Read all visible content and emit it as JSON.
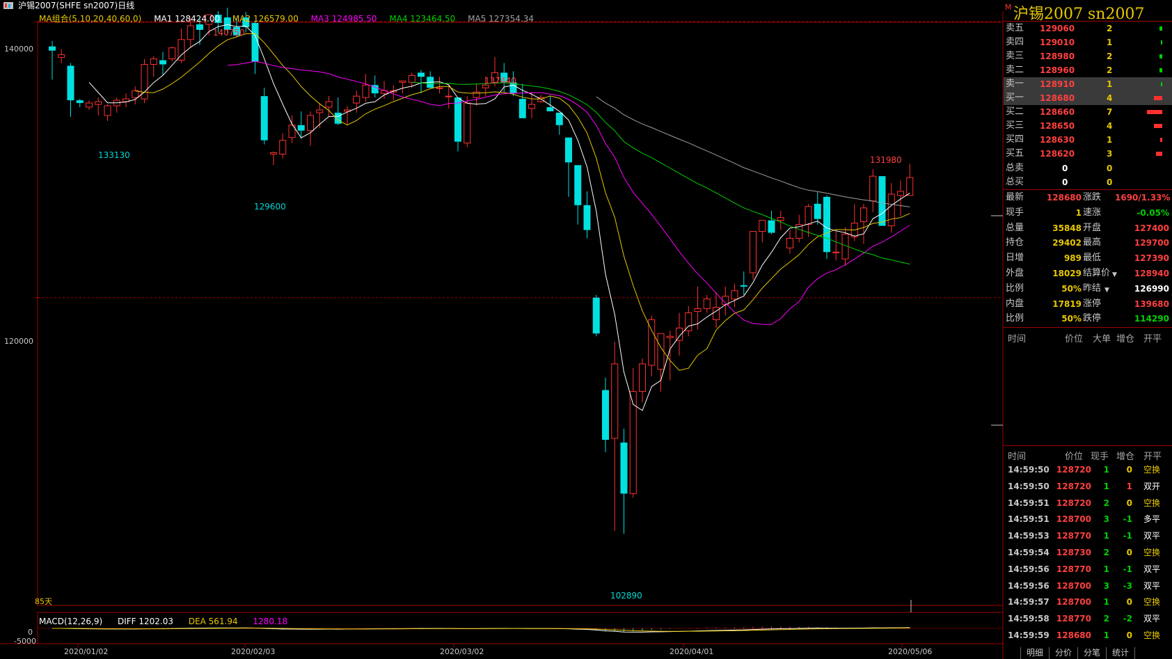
{
  "title": "沪锡2007(SHFE sn2007)日线",
  "ma": {
    "combo": "MA组合(5,10,20,40,60,0)",
    "items": [
      {
        "label": "MA1 128424.00",
        "color": "#ffffff"
      },
      {
        "label": "MA2 126579.00",
        "color": "#e8c800"
      },
      {
        "label": "MA3 124985.50",
        "color": "#ff00ff"
      },
      {
        "label": "MA4 123464.50",
        "color": "#00d000"
      },
      {
        "label": "MA5 127354.34",
        "color": "#a0a0a0"
      }
    ]
  },
  "annotations": {
    "high1": "140750",
    "low1": "133130",
    "low2": "129600",
    "high2": "137440",
    "low3": "102890",
    "high3": "131980"
  },
  "yaxis": {
    "t140k": "140000",
    "t120k": "120000",
    "m0": "0",
    "mneg": "-5000"
  },
  "xaxis": [
    "2020/01/02",
    "2020/02/03",
    "2020/03/02",
    "2020/04/01",
    "2020/05/06"
  ],
  "days_label": "85天",
  "macd": {
    "name": "MACD(12,26,9)",
    "diff": "DIFF 1202.03",
    "dea": "DEA 561.94",
    "macd": "1280.18"
  },
  "chart_data": {
    "type": "candlestick",
    "ylim": [
      101000,
      142500
    ],
    "candles": [
      [
        138200,
        138600,
        135800,
        137900
      ],
      [
        137400,
        138000,
        137000,
        137600
      ],
      [
        136800,
        137000,
        133100,
        134300
      ],
      [
        134300,
        134400,
        133800,
        134100
      ],
      [
        133800,
        134300,
        133600,
        134100
      ],
      [
        134000,
        134500,
        133200,
        134200
      ],
      [
        133200,
        134000,
        132800,
        133900
      ],
      [
        133900,
        134500,
        133400,
        134300
      ],
      [
        134200,
        134800,
        133800,
        134400
      ],
      [
        134500,
        135300,
        134000,
        135000
      ],
      [
        134400,
        137300,
        134100,
        136900
      ],
      [
        136900,
        137500,
        136000,
        137300
      ],
      [
        137200,
        137800,
        136100,
        136900
      ],
      [
        137300,
        138200,
        137100,
        138100
      ],
      [
        137200,
        139500,
        137000,
        138700
      ],
      [
        138700,
        140300,
        138100,
        139700
      ],
      [
        139800,
        140200,
        138300,
        139400
      ],
      [
        139800,
        140100,
        139000,
        140500
      ],
      [
        140500,
        140750,
        139200,
        139900
      ],
      [
        140300,
        141000,
        139200,
        139400
      ],
      [
        139600,
        140300,
        138900,
        139000
      ],
      [
        140300,
        140700,
        139200,
        139600
      ],
      [
        139900,
        140000,
        136200,
        137100
      ],
      [
        134600,
        135200,
        131100,
        131400
      ],
      [
        130400,
        130600,
        129600,
        130500
      ],
      [
        130400,
        131900,
        130100,
        131400
      ],
      [
        131600,
        133200,
        131200,
        132500
      ],
      [
        132500,
        133500,
        131500,
        132100
      ],
      [
        132100,
        133500,
        131000,
        133200
      ],
      [
        133400,
        134100,
        132300,
        133600
      ],
      [
        133800,
        134600,
        133100,
        134200
      ],
      [
        133400,
        134500,
        132500,
        132600
      ],
      [
        133500,
        133900,
        132500,
        133600
      ],
      [
        134100,
        135000,
        133400,
        134600
      ],
      [
        134500,
        136200,
        134200,
        135400
      ],
      [
        135400,
        136100,
        134500,
        134800
      ],
      [
        134800,
        135700,
        134400,
        135000
      ],
      [
        134900,
        135400,
        134300,
        135000
      ],
      [
        135600,
        135700,
        134800,
        135700
      ],
      [
        135600,
        136300,
        135200,
        136100
      ],
      [
        136300,
        136500,
        134800,
        136000
      ],
      [
        136000,
        136400,
        135300,
        135200
      ],
      [
        135200,
        136000,
        134800,
        135200
      ],
      [
        134600,
        135400,
        133700,
        134600
      ],
      [
        134500,
        134500,
        130600,
        131300
      ],
      [
        131200,
        134600,
        130900,
        134100
      ],
      [
        134500,
        135500,
        133900,
        134900
      ],
      [
        135200,
        136000,
        134600,
        135400
      ],
      [
        135600,
        137440,
        135300,
        136300
      ],
      [
        136300,
        137000,
        134900,
        135600
      ],
      [
        135600,
        136400,
        134600,
        134800
      ],
      [
        134400,
        135500,
        133400,
        133000
      ],
      [
        133700,
        134900,
        133000,
        134000
      ],
      [
        134200,
        134700,
        134100,
        134500
      ],
      [
        133800,
        134600,
        133700,
        133500
      ],
      [
        133400,
        133400,
        131800,
        132500
      ],
      [
        131600,
        131600,
        127300,
        129800
      ],
      [
        129600,
        129600,
        125300,
        126700
      ],
      [
        126700,
        127700,
        124300,
        124900
      ],
      [
        120000,
        120200,
        117200,
        117400
      ],
      [
        113300,
        114200,
        108800,
        109700
      ],
      [
        109800,
        116800,
        103100,
        115200
      ],
      [
        109500,
        110500,
        102890,
        105800
      ],
      [
        105800,
        114900,
        105500,
        113200
      ],
      [
        113200,
        115600,
        112400,
        115200
      ],
      [
        115100,
        118700,
        114300,
        118400
      ],
      [
        114800,
        117300,
        113200,
        117400
      ],
      [
        117100,
        117600,
        114000,
        117200
      ],
      [
        116900,
        118900,
        115800,
        117800
      ],
      [
        117600,
        119400,
        117200,
        118900
      ],
      [
        119000,
        120800,
        117700,
        119200
      ],
      [
        119200,
        120200,
        118900,
        119900
      ],
      [
        118400,
        120400,
        117800,
        119300
      ],
      [
        119500,
        120800,
        118700,
        120100
      ],
      [
        119900,
        121000,
        119300,
        120500
      ],
      [
        120900,
        121900,
        120200,
        120800
      ],
      [
        121800,
        124000,
        121300,
        124800
      ],
      [
        124800,
        125500,
        124000,
        125600
      ],
      [
        125600,
        126300,
        124600,
        124700
      ],
      [
        125600,
        126300,
        124900,
        125800
      ],
      [
        123600,
        124900,
        123200,
        124300
      ],
      [
        124300,
        126000,
        124000,
        125300
      ],
      [
        125300,
        126800,
        124400,
        126600
      ],
      [
        126800,
        127700,
        125300,
        125700
      ],
      [
        127300,
        127400,
        122800,
        123300
      ],
      [
        123300,
        124900,
        122700,
        123300
      ],
      [
        122800,
        125100,
        122300,
        124600
      ],
      [
        124400,
        126800,
        124100,
        125400
      ],
      [
        125500,
        126800,
        123900,
        126500
      ],
      [
        127000,
        129300,
        126200,
        128800
      ],
      [
        128800,
        128800,
        126300,
        125200
      ],
      [
        125200,
        128300,
        124700,
        127500
      ],
      [
        127400,
        128500,
        125900,
        127700
      ],
      [
        127400,
        129700,
        127400,
        128700
      ]
    ]
  },
  "right": {
    "title": "沪锡2007  sn2007",
    "mark": "M",
    "orderbook": [
      {
        "name": "卖五",
        "price": "129060",
        "vol": "2",
        "bar": 4,
        "barColor": "#00d000"
      },
      {
        "name": "卖四",
        "price": "129010",
        "vol": "1",
        "bar": 2,
        "barColor": "#00d000"
      },
      {
        "name": "卖三",
        "price": "128980",
        "vol": "2",
        "bar": 4,
        "barColor": "#00d000"
      },
      {
        "name": "卖二",
        "price": "128960",
        "vol": "2",
        "bar": 4,
        "barColor": "#00d000"
      },
      {
        "name": "卖一",
        "price": "128910",
        "vol": "1",
        "bar": 2,
        "barColor": "#00d000",
        "sel": true
      },
      {
        "name": "买一",
        "price": "128680",
        "vol": "4",
        "bar": 12,
        "barColor": "#ff3030",
        "sel": true
      },
      {
        "name": "买二",
        "price": "128660",
        "vol": "7",
        "bar": 22,
        "barColor": "#ff3030"
      },
      {
        "name": "买三",
        "price": "128650",
        "vol": "4",
        "bar": 12,
        "barColor": "#ff3030"
      },
      {
        "name": "买四",
        "price": "128630",
        "vol": "1",
        "bar": 3,
        "barColor": "#ff3030"
      },
      {
        "name": "买五",
        "price": "128620",
        "vol": "3",
        "bar": 9,
        "barColor": "#ff3030"
      }
    ],
    "totals": [
      {
        "name": "总卖",
        "v1": "0",
        "v2": "0"
      },
      {
        "name": "总买",
        "v1": "0",
        "v2": "0"
      }
    ],
    "quote": [
      {
        "k1": "最新",
        "v1": "128680",
        "c1": "#ff4040",
        "k2": "涨跌",
        "v2": "1690/1.33%",
        "c2": "#ff4040"
      },
      {
        "k1": "现手",
        "v1": "1",
        "c1": "#e8c800",
        "k2": "速涨",
        "v2": "-0.05%",
        "c2": "#00d000"
      },
      {
        "k1": "总量",
        "v1": "35848",
        "c1": "#e8c800",
        "k2": "开盘",
        "v2": "127400",
        "c2": "#ff4040"
      },
      {
        "k1": "持仓",
        "v1": "29402",
        "c1": "#e8c800",
        "k2": "最高",
        "v2": "129700",
        "c2": "#ff4040"
      },
      {
        "k1": "日增",
        "v1": "989",
        "c1": "#e8c800",
        "k2": "最低",
        "v2": "127390",
        "c2": "#ff4040"
      },
      {
        "k1": "外盘",
        "v1": "18029",
        "c1": "#e8c800",
        "k2": "结算价",
        "v2": "128940",
        "c2": "#ff4040"
      },
      {
        "k1": "比例",
        "v1": "50%",
        "c1": "#e8c800",
        "k2": "昨结",
        "v2": "126990",
        "c2": "#ffffff"
      },
      {
        "k1": "内盘",
        "v1": "17819",
        "c1": "#e8c800",
        "k2": "涨停",
        "v2": "139680",
        "c2": "#ff4040"
      },
      {
        "k1": "比例",
        "v1": "50%",
        "c1": "#e8c800",
        "k2": "跌停",
        "v2": "114290",
        "c2": "#00d000"
      }
    ],
    "bigorder_header": {
      "time": "时间",
      "price": "价位",
      "big": "大单",
      "inc": "增仓",
      "oc": "开平"
    },
    "tick_header": {
      "time": "时间",
      "price": "价位",
      "now": "现手",
      "inc": "增仓",
      "oc": "开平"
    },
    "ticks": [
      {
        "time": "14:59:50",
        "price": "128720",
        "now": "1",
        "inc": "0",
        "oc": "空换"
      },
      {
        "time": "14:59:50",
        "price": "128720",
        "now": "1",
        "inc": "1",
        "oc": "双开"
      },
      {
        "time": "14:59:51",
        "price": "128720",
        "now": "2",
        "inc": "0",
        "oc": "空换"
      },
      {
        "time": "14:59:51",
        "price": "128700",
        "now": "3",
        "inc": "-1",
        "oc": "多平"
      },
      {
        "time": "14:59:53",
        "price": "128770",
        "now": "1",
        "inc": "-1",
        "oc": "双平"
      },
      {
        "time": "14:59:54",
        "price": "128730",
        "now": "2",
        "inc": "0",
        "oc": "空换"
      },
      {
        "time": "14:59:56",
        "price": "128770",
        "now": "1",
        "inc": "-1",
        "oc": "双平"
      },
      {
        "time": "14:59:56",
        "price": "128700",
        "now": "3",
        "inc": "-3",
        "oc": "双平"
      },
      {
        "time": "14:59:57",
        "price": "128700",
        "now": "1",
        "inc": "0",
        "oc": "空换"
      },
      {
        "time": "14:59:58",
        "price": "128770",
        "now": "2",
        "inc": "-2",
        "oc": "双平"
      },
      {
        "time": "14:59:59",
        "price": "128680",
        "now": "1",
        "inc": "0",
        "oc": "空换"
      }
    ],
    "tabs": [
      "明细",
      "分价",
      "分笔",
      "统计"
    ]
  }
}
